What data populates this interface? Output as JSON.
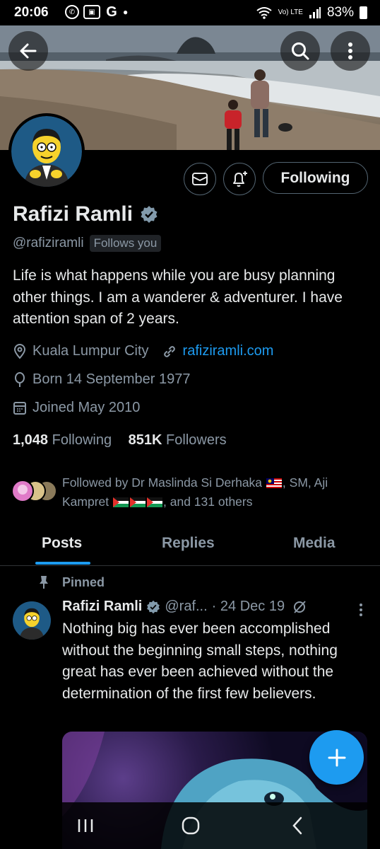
{
  "status_bar": {
    "time": "20:06",
    "network_label": "Vo) LTE",
    "battery": "83%"
  },
  "profile": {
    "name": "Rafizi Ramli",
    "handle": "@rafiziramli",
    "follows_you": "Follows you",
    "follow_button": "Following",
    "bio": "Life is what happens while you are busy planning other things. I am a wanderer & adventurer. I have attention span of 2 years.",
    "location": "Kuala Lumpur City",
    "website": "rafiziramli.com",
    "born": "Born 14 September 1977",
    "joined": "Joined May 2010",
    "following_count": "1,048",
    "following_label": "Following",
    "followers_count": "851K",
    "followers_label": "Followers",
    "followed_by_prefix": "Followed by Dr Maslinda Si Derhaka",
    "followed_by_mid": ", SM, Aji Kampret",
    "followed_by_suffix": ", and 131 others"
  },
  "tabs": [
    {
      "label": "Posts",
      "active": true
    },
    {
      "label": "Replies",
      "active": false
    },
    {
      "label": "Media",
      "active": false
    }
  ],
  "pinned_post": {
    "pinned_label": "Pinned",
    "author": "Rafizi Ramli",
    "handle": "@raf...",
    "date": "· 24 Dec 19",
    "text": "Nothing big has ever been accomplished without the beginning small steps, nothing great has ever been achieved without the determination of the first few believers."
  },
  "icons": {
    "back": "back-arrow-icon",
    "search": "search-icon",
    "more": "more-vertical-icon",
    "message": "envelope-icon",
    "notify": "bell-plus-icon",
    "verified": "verified-badge-icon",
    "location": "location-pin-icon",
    "link": "link-icon",
    "birthday": "balloon-icon",
    "calendar": "calendar-icon",
    "pin": "pin-icon",
    "compose": "plus-icon"
  },
  "colors": {
    "accent": "#1d9bf0",
    "background": "#000000",
    "text_primary": "#e7e9ea",
    "text_secondary": "#8b98a5"
  }
}
